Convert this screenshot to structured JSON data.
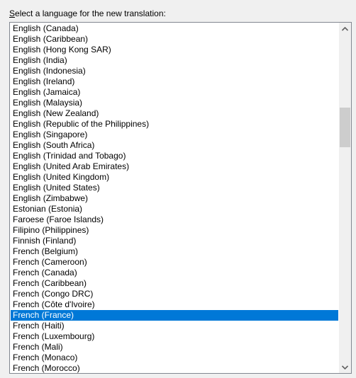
{
  "dialog": {
    "label_accel": "S",
    "label_rest": "elect a language for the new translation:"
  },
  "list": {
    "selected_index": 27,
    "items": [
      "English (Canada)",
      "English (Caribbean)",
      "English (Hong Kong SAR)",
      "English (India)",
      "English (Indonesia)",
      "English (Ireland)",
      "English (Jamaica)",
      "English (Malaysia)",
      "English (New Zealand)",
      "English (Republic of the Philippines)",
      "English (Singapore)",
      "English (South Africa)",
      "English (Trinidad and Tobago)",
      "English (United Arab Emirates)",
      "English (United Kingdom)",
      "English (United States)",
      "English (Zimbabwe)",
      "Estonian (Estonia)",
      "Faroese (Faroe Islands)",
      "Filipino (Philippines)",
      "Finnish (Finland)",
      "French (Belgium)",
      "French (Cameroon)",
      "French (Canada)",
      "French (Caribbean)",
      "French (Congo DRC)",
      "French (Côte d'Ivoire)",
      "French (France)",
      "French (Haiti)",
      "French (Luxembourg)",
      "French (Mali)",
      "French (Monaco)",
      "French (Morocco)"
    ]
  },
  "scrollbar": {
    "up_icon": "chevron-up-icon",
    "down_icon": "chevron-down-icon"
  },
  "colors": {
    "selection": "#0078d7",
    "border": "#828790"
  }
}
